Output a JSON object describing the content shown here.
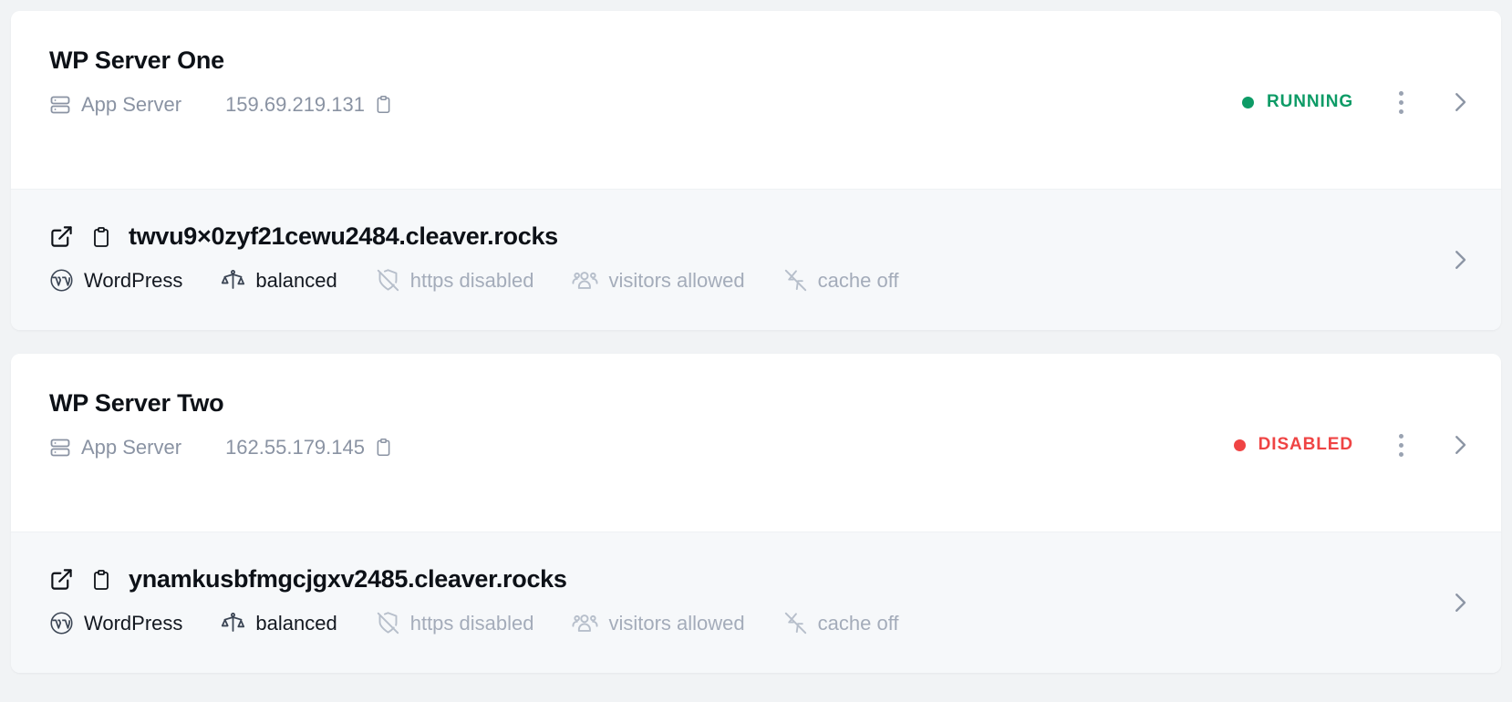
{
  "colors": {
    "page_background": "#f1f3f5",
    "card_background": "#ffffff",
    "site_row_background": "#f6f8fa",
    "status_running": "#0d9b66",
    "status_disabled": "#ef4444",
    "muted_text": "#a4acba",
    "primary_text": "#0d1117"
  },
  "servers": [
    {
      "name": "WP Server One",
      "kind_label": "App Server",
      "kind_icon": "server-icon",
      "ip": "159.69.219.131",
      "copy_icon": "clipboard-icon",
      "status": {
        "label": "RUNNING",
        "state": "running"
      },
      "menu_icon": "kebab-menu-icon",
      "expand_icon": "chevron-right-icon",
      "site": {
        "open_icon": "external-link-icon",
        "copy_icon": "clipboard-icon",
        "domain": "twvu9×0zyf21cewu2484.cleaver.rocks",
        "expand_icon": "chevron-right-icon",
        "meta": [
          {
            "icon": "wordpress-icon",
            "label": "WordPress",
            "muted": false
          },
          {
            "icon": "scales-balance-icon",
            "label": "balanced",
            "muted": false
          },
          {
            "icon": "shield-off-icon",
            "label": "https disabled",
            "muted": true
          },
          {
            "icon": "users-icon",
            "label": "visitors allowed",
            "muted": true
          },
          {
            "icon": "zap-off-icon",
            "label": "cache off",
            "muted": true
          }
        ]
      }
    },
    {
      "name": "WP Server Two",
      "kind_label": "App Server",
      "kind_icon": "server-icon",
      "ip": "162.55.179.145",
      "copy_icon": "clipboard-icon",
      "status": {
        "label": "DISABLED",
        "state": "disabled"
      },
      "menu_icon": "kebab-menu-icon",
      "expand_icon": "chevron-right-icon",
      "site": {
        "open_icon": "external-link-icon",
        "copy_icon": "clipboard-icon",
        "domain": "ynamkusbfmgcjgxv2485.cleaver.rocks",
        "expand_icon": "chevron-right-icon",
        "meta": [
          {
            "icon": "wordpress-icon",
            "label": "WordPress",
            "muted": false
          },
          {
            "icon": "scales-balance-icon",
            "label": "balanced",
            "muted": false
          },
          {
            "icon": "shield-off-icon",
            "label": "https disabled",
            "muted": true
          },
          {
            "icon": "users-icon",
            "label": "visitors allowed",
            "muted": true
          },
          {
            "icon": "zap-off-icon",
            "label": "cache off",
            "muted": true
          }
        ]
      }
    }
  ]
}
